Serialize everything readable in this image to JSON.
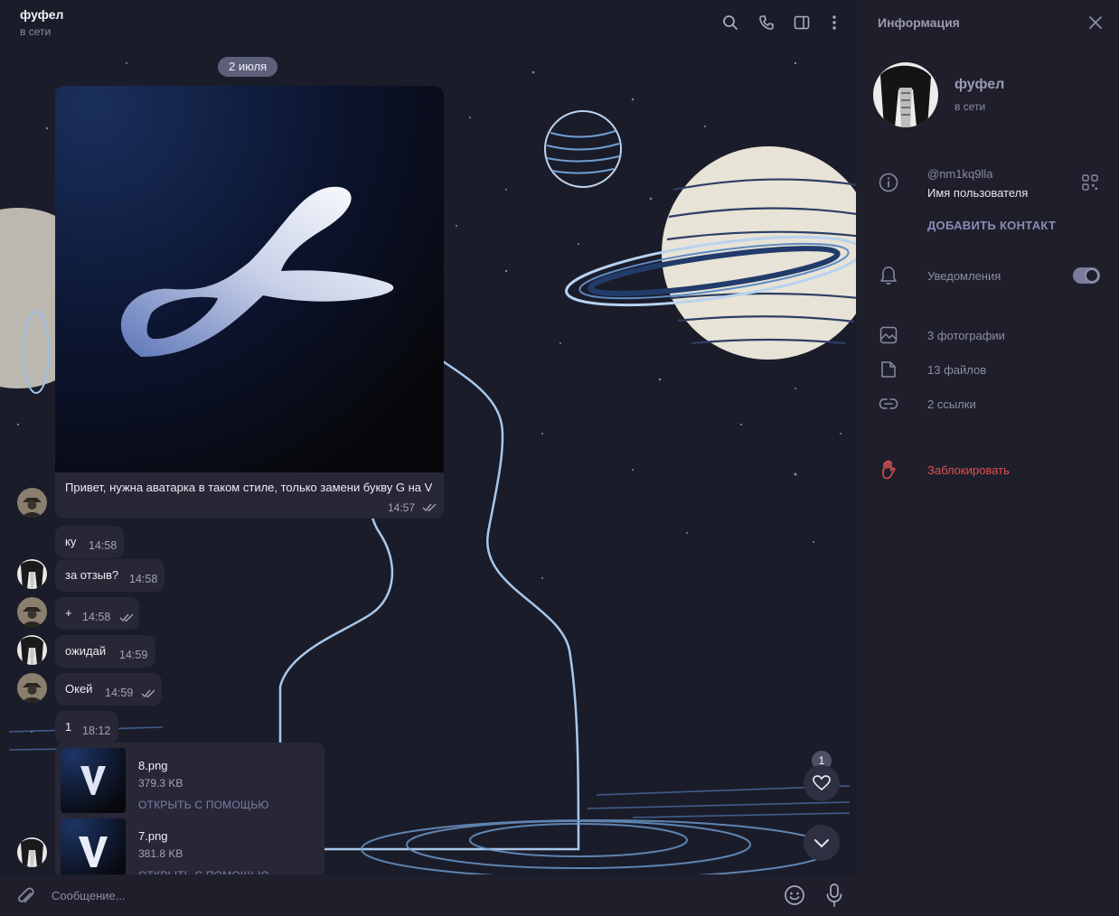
{
  "chat": {
    "title": "фуфел",
    "status": "в сети",
    "date": "2 июля",
    "image_message": {
      "caption": "Привет, нужна аватарка в таком стиле, только замени букву G на V",
      "time": "14:57"
    },
    "messages": [
      {
        "text": "ку",
        "time": "14:58"
      },
      {
        "text": "за отзыв?",
        "time": "14:58"
      },
      {
        "text": "+",
        "time": "14:58"
      },
      {
        "text": "ожидай",
        "time": "14:59"
      },
      {
        "text": "Окей",
        "time": "14:59"
      },
      {
        "text": "1",
        "time": "18:12"
      }
    ],
    "files": [
      {
        "name": "8.png",
        "size": "379.3 KB",
        "action": "ОТКРЫТЬ С ПОМОЩЬЮ"
      },
      {
        "name": "7.png",
        "size": "381.8 KB",
        "action": "ОТКРЫТЬ С ПОМОЩЬЮ"
      }
    ],
    "unread_reactions": "1",
    "composer_placeholder": "Сообщение..."
  },
  "info": {
    "title": "Информация",
    "name": "фуфел",
    "status": "в сети",
    "username": "@nm1kq9lla",
    "username_label": "Имя пользователя",
    "add_contact": "ДОБАВИТЬ КОНТАКТ",
    "notifications": "Уведомления",
    "notifications_on": true,
    "photos": "3 фотографии",
    "files": "13 файлов",
    "links": "2 ссылки",
    "block": "Заблокировать"
  },
  "colors": {
    "accent": "#8a8ab6",
    "danger": "#e05050",
    "bubble": "#272736",
    "panel": "#1f1f2b"
  }
}
